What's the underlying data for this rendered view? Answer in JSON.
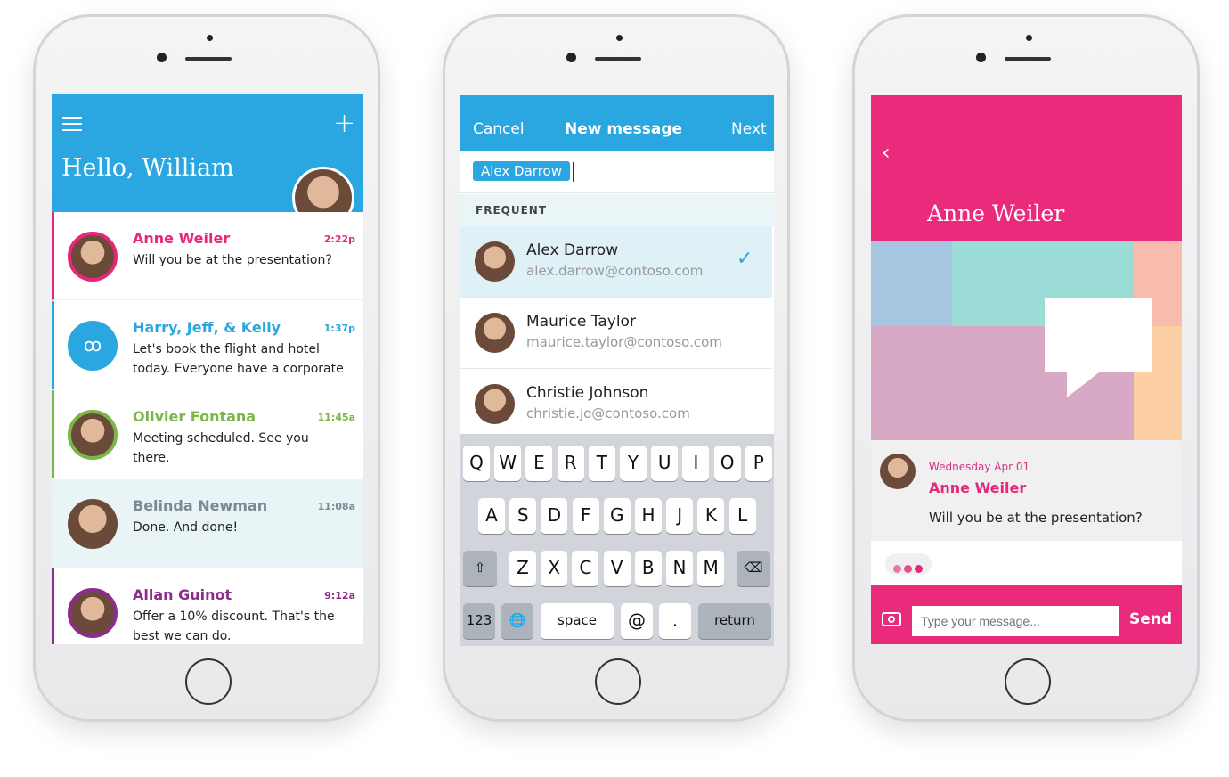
{
  "phone1": {
    "greeting": "Hello, William",
    "icons": {
      "menu": "hamburger-icon",
      "add": "plus-icon"
    },
    "accent": "#2aa7e0",
    "conversations": [
      {
        "name": "Anne Weiler",
        "time": "2:22p",
        "message": "Will you be at the presentation?",
        "color": "#e6287a"
      },
      {
        "name": "Harry, Jeff, & Kelly",
        "time": "1:37p",
        "message": "Let's book the flight and hotel today. Everyone have a corporate",
        "color": "#2aa7e0"
      },
      {
        "name": "Olivier Fontana",
        "time": "11:45a",
        "message": "Meeting scheduled. See you there.",
        "color": "#7ab648"
      },
      {
        "name": "Belinda Newman",
        "time": "11:08a",
        "message": "Done. And done!",
        "color": "#7d8a90"
      },
      {
        "name": "Allan Guinot",
        "time": "9:12a",
        "message": "Offer a 10% discount. That's the best we can do.",
        "color": "#8b2c8e"
      }
    ]
  },
  "phone2": {
    "cancel": "Cancel",
    "title": "New message",
    "next": "Next",
    "recipient": "Alex Darrow",
    "section": "FREQUENT",
    "contacts": [
      {
        "name": "Alex Darrow",
        "email": "alex.darrow@contoso.com",
        "selected": true
      },
      {
        "name": "Maurice Taylor",
        "email": "maurice.taylor@contoso.com",
        "selected": false
      },
      {
        "name": "Christie Johnson",
        "email": "christie.jo@contoso.com",
        "selected": false
      }
    ],
    "keyboard": {
      "row1": [
        "Q",
        "W",
        "E",
        "R",
        "T",
        "Y",
        "U",
        "I",
        "O",
        "P"
      ],
      "row2": [
        "A",
        "S",
        "D",
        "F",
        "G",
        "H",
        "J",
        "K",
        "L"
      ],
      "row3": [
        "Z",
        "X",
        "C",
        "V",
        "B",
        "N",
        "M"
      ],
      "num": "123",
      "space": "space",
      "at": "@",
      "period": ".",
      "return": "return"
    }
  },
  "phone3": {
    "title": "Anne Weiler",
    "accent": "#ea2a7b",
    "date": "Wednesday Apr 01",
    "sender": "Anne Weiler",
    "message": "Will you be at the presentation?",
    "placeholder": "Type your message...",
    "send": "Send"
  }
}
